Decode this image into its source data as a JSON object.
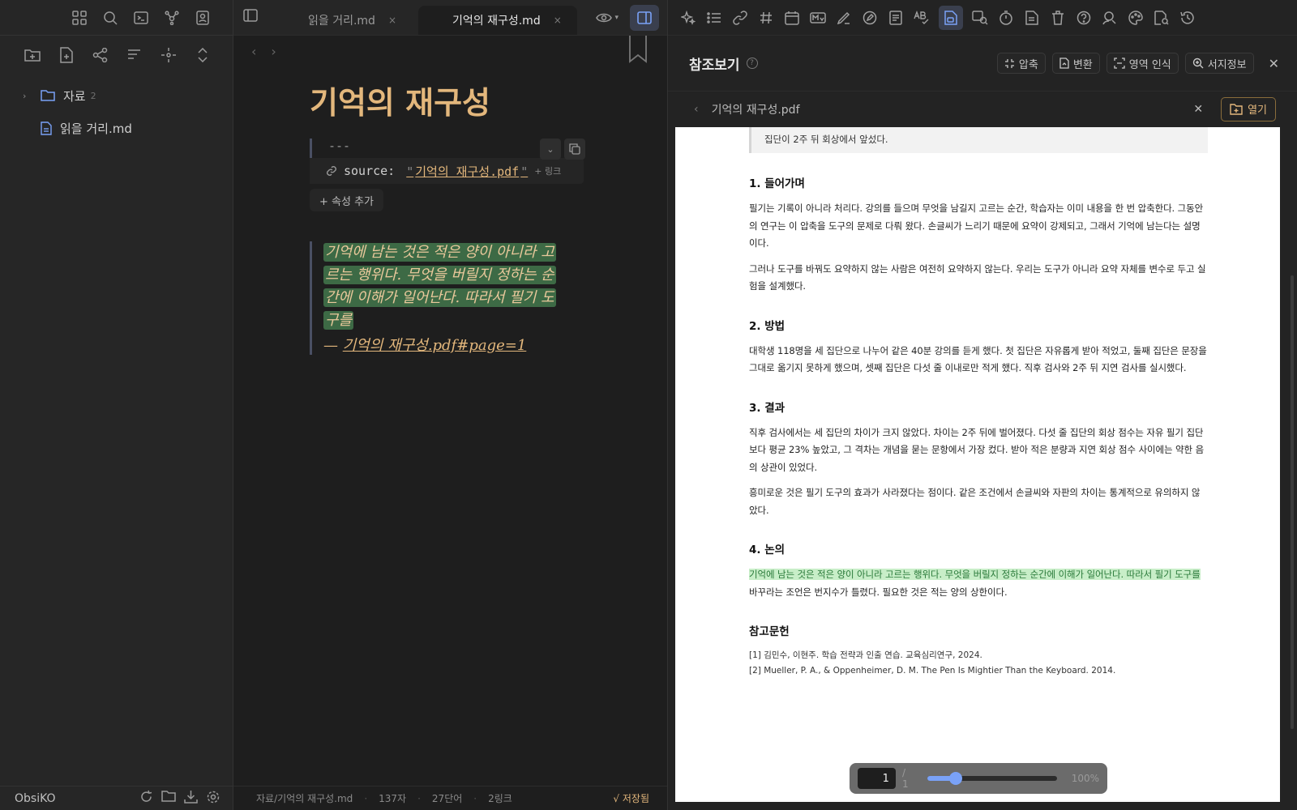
{
  "sidebar": {
    "ribbon_icons": [
      "grid-icon",
      "search-icon",
      "terminal-icon",
      "graph-icon",
      "contact-icon"
    ],
    "nav_icons": [
      "new-folder-icon",
      "new-note-icon",
      "tags-icon",
      "sort-icon",
      "locate-icon",
      "expand-icon"
    ],
    "tree": [
      {
        "type": "folder",
        "label": "자료",
        "count": "2"
      },
      {
        "type": "file",
        "label": "읽을 거리.md"
      }
    ],
    "vault_name": "ObsiKO"
  },
  "editor": {
    "tabs": [
      {
        "label": "읽을 거리.md",
        "active": false
      },
      {
        "label": "기억의 재구성.md",
        "active": true
      }
    ],
    "title": "기억의 재구성",
    "frontmatter": {
      "delimiter": "---",
      "key": "source:",
      "value": "기억의 재구성.pdf",
      "link_hint": "+ 링크"
    },
    "add_property": "+ 속성 추가",
    "quote": {
      "lines": [
        "기억에 남는 것은 적은 양이 아니라 고",
        "르는 행위다. 무엇을 버릴지 정하는 순",
        "간에 이해가 일어난다. 따라서 필기 도",
        "구를"
      ],
      "source_prefix": "— ",
      "source_link": "기억의 재구성.pdf#page=1"
    },
    "status": {
      "path": "자료/기억의 재구성.md",
      "chars": "137자",
      "words": "27단어",
      "links": "2링크",
      "saved": "√ 저장됨"
    }
  },
  "right_pane": {
    "header_title": "참조보기",
    "help": "?",
    "actions": [
      {
        "label": "압축",
        "icon": "compress-icon"
      },
      {
        "label": "변환",
        "icon": "convert-icon"
      },
      {
        "label": "영역 인식",
        "icon": "region-icon"
      },
      {
        "label": "서지정보",
        "icon": "zoom-info-icon"
      }
    ],
    "file_name": "기억의 재구성.pdf",
    "open_label": "열기",
    "pdf": {
      "top_quote": "집단이 2주 뒤 회상에서 앞섰다.",
      "sections": [
        {
          "heading": "1. 들어가며",
          "paragraphs": [
            "필기는 기록이 아니라 처리다. 강의를 들으며 무엇을 남길지 고르는 순간, 학습자는 이미 내용을 한 번 압축한다. 그동안의 연구는 이 압축을 도구의 문제로 다뤄 왔다. 손글씨가 느리기 때문에 요약이 강제되고, 그래서 기억에 남는다는 설명이다.",
            "그러나 도구를 바꿔도 요약하지 않는 사람은 여전히 요약하지 않는다. 우리는 도구가 아니라 요약 자체를 변수로 두고 실험을 설계했다."
          ]
        },
        {
          "heading": "2. 방법",
          "paragraphs": [
            "대학생 118명을 세 집단으로 나누어 같은 40분 강의를 듣게 했다. 첫 집단은 자유롭게 받아 적었고, 둘째 집단은 문장을 그대로 옮기지 못하게 했으며, 셋째 집단은 다섯 줄 이내로만 적게 했다. 직후 검사와 2주 뒤 지연 검사를 실시했다."
          ]
        },
        {
          "heading": "3. 결과",
          "paragraphs": [
            "직후 검사에서는 세 집단의 차이가 크지 않았다. 차이는 2주 뒤에 벌어졌다. 다섯 줄 집단의 회상 점수는 자유 필기 집단보다 평균 23% 높았고, 그 격차는 개념을 묻는 문항에서 가장 컸다. 받아 적은 분량과 지연 회상 점수 사이에는 약한 음의 상관이 있었다.",
            "흥미로운 것은 필기 도구의 효과가 사라졌다는 점이다. 같은 조건에서 손글씨와 자판의 차이는 통계적으로 유의하지 않았다."
          ]
        }
      ],
      "discussion": {
        "heading": "4. 논의",
        "highlight": "기억에 남는 것은 적은 양이 아니라 고르는 행위다. 무엇을 버릴지 정하는 순간에 이해가 일어난다. 따라서 필기 도구를",
        "rest": "바꾸라는 조언은 번지수가 틀렸다. 필요한 것은 적는 양의 상한이다."
      },
      "references_heading": "참고문헌",
      "references": [
        "[1] 김민수, 이현주. 학습 전략과 인출 연습. 교육심리연구, 2024.",
        "[2] Mueller, P. A., & Oppenheimer, D. M. The Pen Is Mightier Than the Keyboard. 2014."
      ]
    },
    "page_nav": {
      "page": "1",
      "total": "/ 1",
      "zoom": "100%",
      "zoom_level": 0.22
    }
  },
  "colors": {
    "accent": "#e3b77c",
    "highlight_dark": "#3d6a45",
    "highlight_light": "#c8eec8",
    "active_blue": "#7aa2f7"
  }
}
